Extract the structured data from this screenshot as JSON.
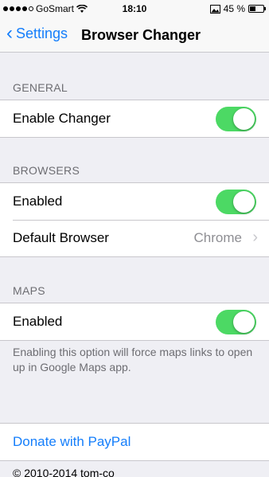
{
  "status_bar": {
    "carrier": "GoSmart",
    "time": "18:10",
    "battery_percent": "45 %",
    "battery_level": 0.45
  },
  "nav": {
    "back_label": "Settings",
    "title": "Browser Changer"
  },
  "general": {
    "header": "GENERAL",
    "enable_changer_label": "Enable Changer",
    "enable_changer_on": true
  },
  "browsers": {
    "header": "BROWSERS",
    "enabled_label": "Enabled",
    "enabled_on": true,
    "default_browser_label": "Default Browser",
    "default_browser_value": "Chrome"
  },
  "maps": {
    "header": "MAPS",
    "enabled_label": "Enabled",
    "enabled_on": true,
    "footnote": "Enabling this option will force maps links to open up in Google Maps app."
  },
  "donate": {
    "label": "Donate with PayPal"
  },
  "copyright": "© 2010-2014 tom-co",
  "colors": {
    "accent": "#147efb",
    "switch_on": "#4cd964",
    "background": "#efeff4"
  }
}
